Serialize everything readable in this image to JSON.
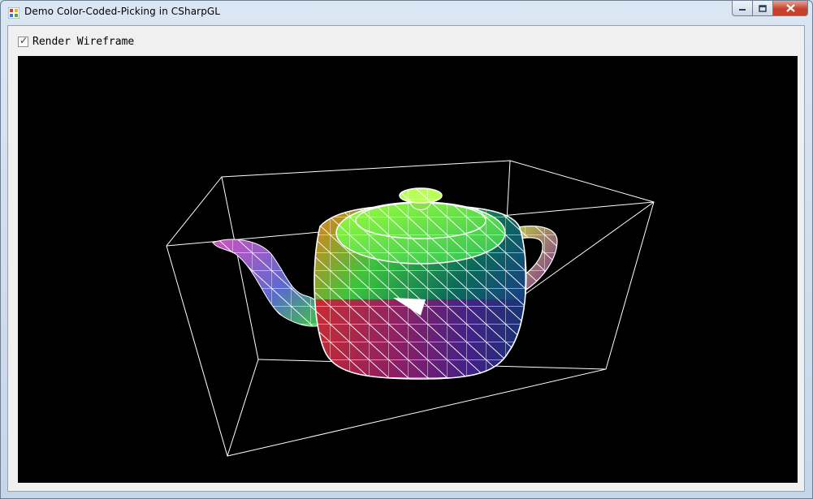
{
  "window": {
    "title": "Demo Color-Coded-Picking in CSharpGL",
    "icon": "app-form-icon",
    "controls": {
      "minimize": "minimize-icon",
      "maximize": "maximize-icon",
      "close": "close-icon"
    }
  },
  "toolbar": {
    "wireframe_checkbox": {
      "label": "Render Wireframe",
      "checked": true
    }
  },
  "viewport": {
    "background": "#000000",
    "model": "teapot",
    "wireframe_color": "#ffffff",
    "bounding_box_color": "#ffffff"
  },
  "colors": {
    "accent_close": "#c7432d",
    "client_bg": "#f0f0f0",
    "frame": "#c6d6e9"
  }
}
